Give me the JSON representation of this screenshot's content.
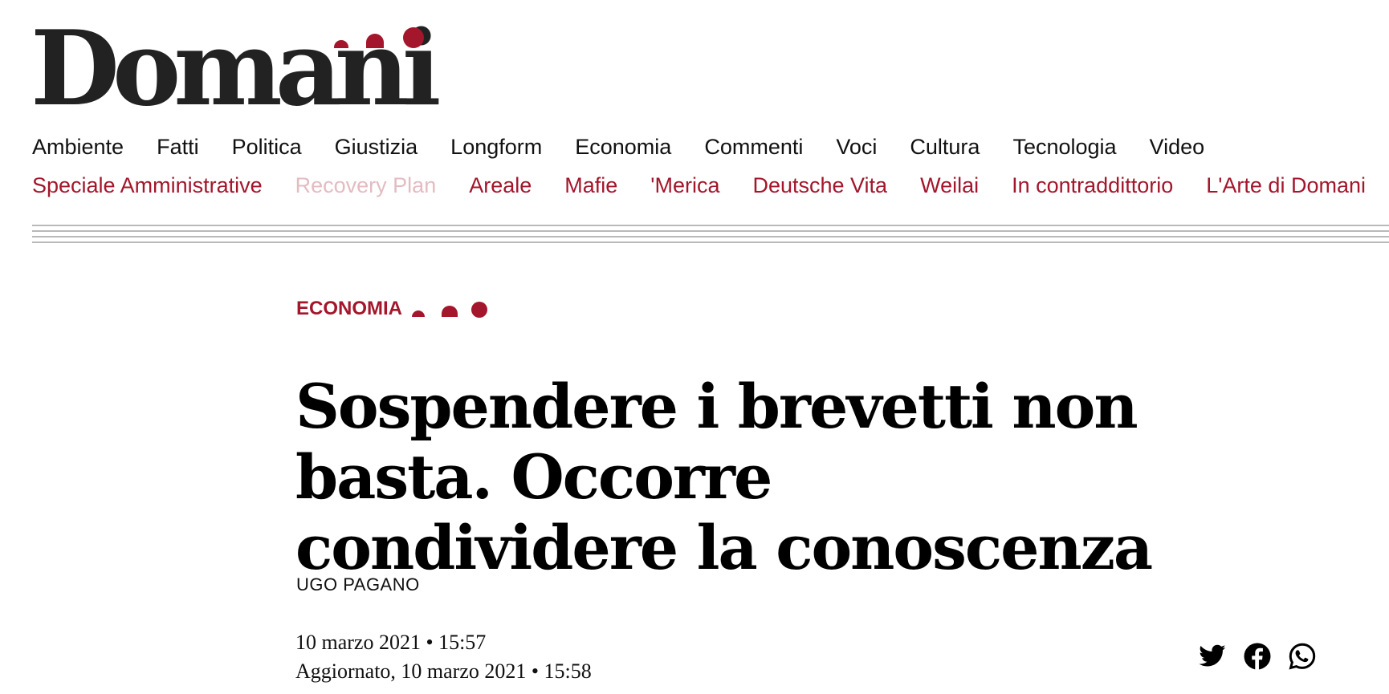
{
  "brand": {
    "logo_text": "Domani",
    "accent_color": "#a3162b"
  },
  "nav": {
    "primary": [
      "Ambiente",
      "Fatti",
      "Politica",
      "Giustizia",
      "Longform",
      "Economia",
      "Commenti",
      "Voci",
      "Cultura",
      "Tecnologia",
      "Video"
    ],
    "secondary": [
      "Speciale Amministrative",
      "Recovery Plan",
      "Areale",
      "Mafie",
      "'Merica",
      "Deutsche Vita",
      "Weilai",
      "In contraddittorio",
      "L'Arte di Domani"
    ]
  },
  "article": {
    "section": "ECONOMIA",
    "title": "Sospendere i brevetti non basta. Occorre condividere la conoscenza",
    "author": "UGO PAGANO",
    "published": "10 marzo 2021 • 15:57",
    "updated": "Aggiornato, 10 marzo 2021 • 15:58"
  },
  "share": {
    "icons": [
      "twitter-icon",
      "facebook-icon",
      "whatsapp-icon"
    ]
  }
}
